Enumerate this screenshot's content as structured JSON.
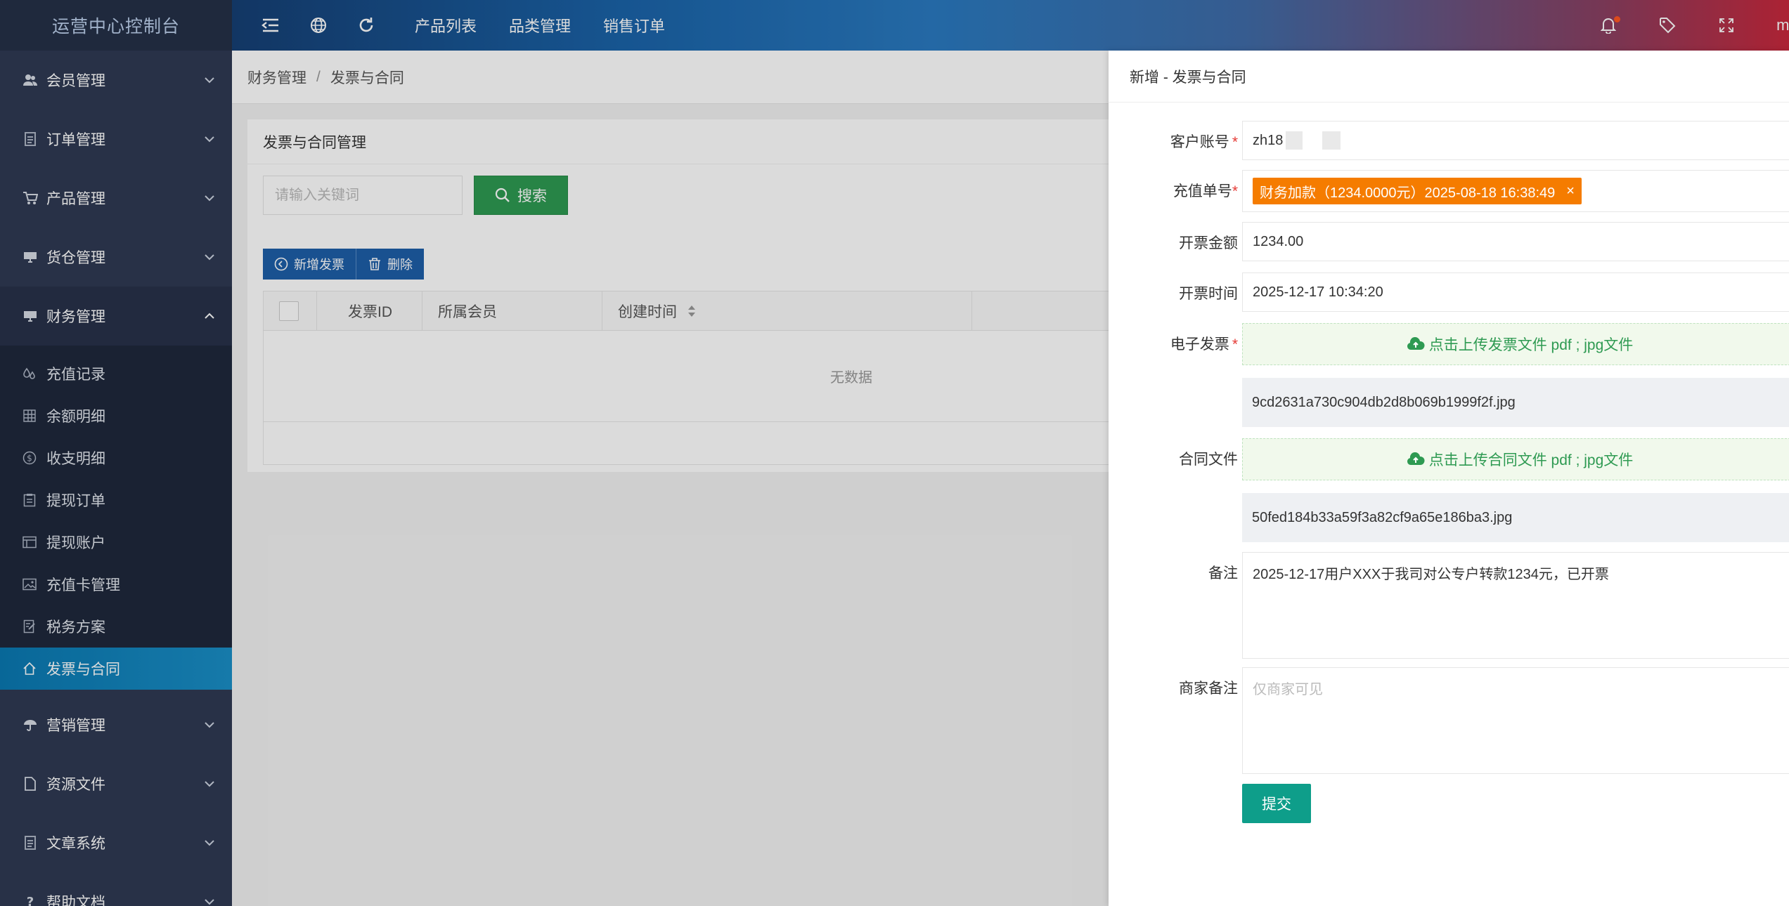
{
  "sidebar": {
    "logo": "运营中心控制台",
    "groups_top": [
      {
        "label": "会员管理",
        "icon": "users-icon"
      },
      {
        "label": "订单管理",
        "icon": "document-icon"
      },
      {
        "label": "产品管理",
        "icon": "cart-icon"
      },
      {
        "label": "货仓管理",
        "icon": "monitor-icon"
      }
    ],
    "finance": {
      "label": "财务管理",
      "icon": "monitor-icon"
    },
    "finance_items": [
      {
        "label": "充值记录",
        "icon": "drops-icon"
      },
      {
        "label": "余额明细",
        "icon": "grid-icon"
      },
      {
        "label": "收支明细",
        "icon": "dollar-icon"
      },
      {
        "label": "提现订单",
        "icon": "clipboard-icon"
      },
      {
        "label": "提现账户",
        "icon": "window-icon"
      },
      {
        "label": "充值卡管理",
        "icon": "image-icon"
      },
      {
        "label": "税务方案",
        "icon": "edit-icon"
      },
      {
        "label": "发票与合同",
        "icon": "home-icon",
        "active": true
      }
    ],
    "groups_bottom": [
      {
        "label": "营销管理",
        "icon": "umbrella-icon"
      },
      {
        "label": "资源文件",
        "icon": "file-icon"
      },
      {
        "label": "文章系统",
        "icon": "document-icon"
      },
      {
        "label": "帮助文档",
        "icon": "question-icon"
      }
    ]
  },
  "header": {
    "links": [
      "产品列表",
      "品类管理",
      "销售订单"
    ],
    "username": "mar"
  },
  "breadcrumb": {
    "parent": "财务管理",
    "sep": "/",
    "current": "发票与合同"
  },
  "card": {
    "title": "发票与合同管理",
    "search_placeholder": "请输入关键词",
    "search_label": "搜索",
    "add_label": "新增发票",
    "delete_label": "删除",
    "columns": [
      "发票ID",
      "所属会员",
      "创建时间"
    ],
    "empty_text": "无数据"
  },
  "drawer": {
    "title": "新增 - 发票与合同",
    "account_label": "客户账号",
    "account_value": "zh18",
    "order_label": "充值单号",
    "order_tag": "财务加款（1234.0000元）2025-08-18 16:38:49",
    "order_tag_close": "×",
    "amount_label": "开票金额",
    "amount_value": "1234.00",
    "time_label": "开票时间",
    "time_value": "2025-12-17 10:34:20",
    "invoice_label": "电子发票",
    "invoice_upload": "点击上传发票文件 pdf ; jpg文件",
    "invoice_file": "9cd2631a730c904db2d8b069b1999f2f.jpg",
    "contract_label": "合同文件",
    "contract_upload": "点击上传合同文件 pdf ; jpg文件",
    "contract_file": "50fed184b33a59f3a82cf9a65e186ba3.jpg",
    "remark_label": "备注",
    "remark_value": "2025-12-17用户XXX于我司对公专户转款1234元，已开票",
    "merchant_label": "商家备注",
    "merchant_placeholder": "仅商家可见",
    "required_mark": "*",
    "submit_label": "提交"
  }
}
